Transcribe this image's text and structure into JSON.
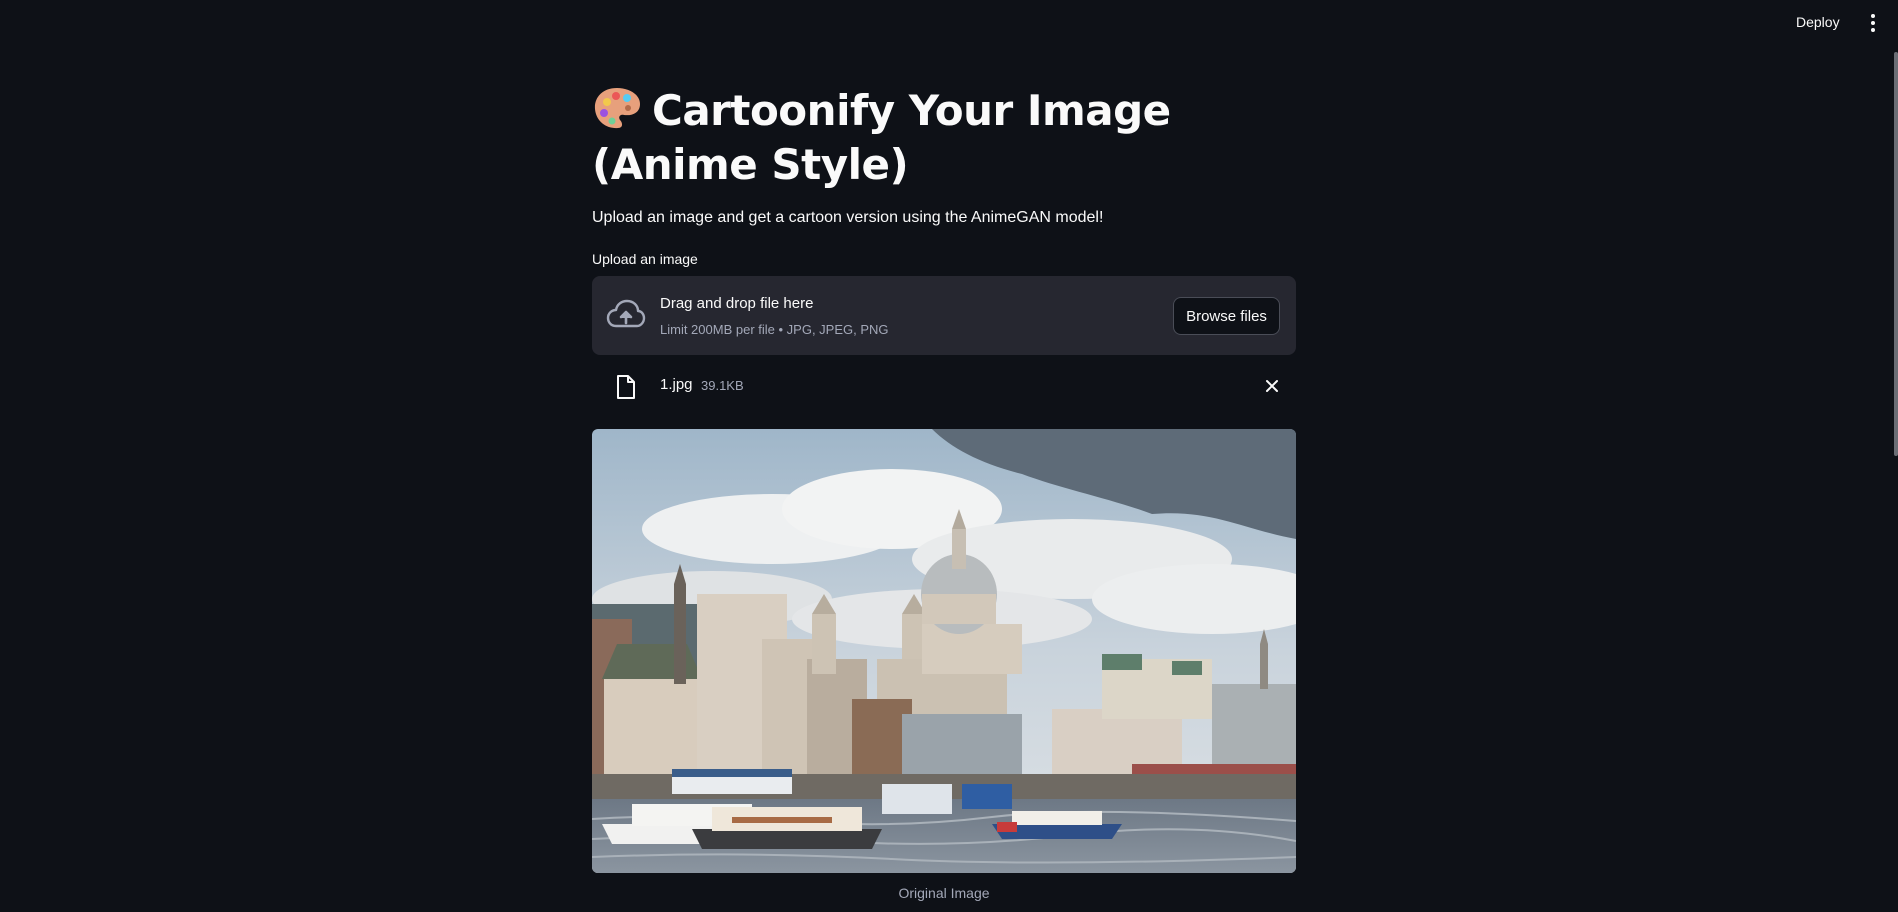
{
  "header": {
    "deploy_label": "Deploy",
    "menu_icon": "kebab-menu-icon"
  },
  "main": {
    "title": "Cartoonify Your Image (Anime Style)",
    "title_icon": "artist-palette-icon",
    "subtitle": "Upload an image and get a cartoon version using the AnimeGAN model!",
    "uploader": {
      "label": "Upload an image",
      "drop_title": "Drag and drop file here",
      "drop_limit": "Limit 200MB per file • JPG, JPEG, PNG",
      "browse_label": "Browse files",
      "icon": "cloud-upload-icon"
    },
    "file": {
      "name": "1.jpg",
      "size": "39.1KB",
      "icon": "file-icon",
      "remove_icon": "close-icon"
    },
    "image_caption": "Original Image"
  },
  "colors": {
    "background": "#0e1117",
    "dropzone": "#262730",
    "text": "#fafafa",
    "muted": "#a3a8b8"
  }
}
